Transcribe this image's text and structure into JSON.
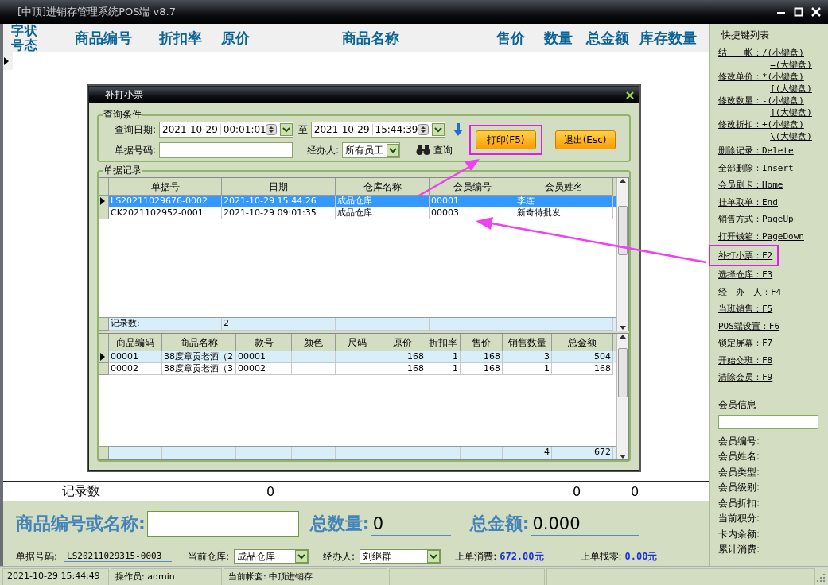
{
  "window": {
    "title": "[中顶]进销存管理系统POS端 v8.7"
  },
  "grid": {
    "columns": [
      {
        "label": "字号",
        "kind": "vertical"
      },
      {
        "label": "状态",
        "kind": "vertical"
      },
      {
        "label": "商品编号",
        "kind": "normal"
      },
      {
        "label": "折扣率",
        "kind": "normal"
      },
      {
        "label": "原价",
        "kind": "normal"
      },
      {
        "label": "商品名称",
        "kind": "normal"
      },
      {
        "label": "售价",
        "kind": "normal"
      },
      {
        "label": "数量",
        "kind": "normal"
      },
      {
        "label": "总金额",
        "kind": "normal"
      },
      {
        "label": "库存数量",
        "kind": "normal"
      }
    ],
    "summary": {
      "label": "记录数",
      "values": [
        "0",
        "0",
        "0"
      ]
    }
  },
  "entry": {
    "search_label": "商品编号或名称:",
    "qty_label": "总数量:",
    "qty": "0",
    "amount_label": "总金额:",
    "amount": "0.000"
  },
  "info": {
    "bill_label": "单据号码:",
    "bill": "LS20211029315-0003",
    "warehouse_label": "当前仓库:",
    "warehouse": "成品仓库",
    "handler_label": "经办人:",
    "handler": "刘继群",
    "last_spend_label": "上单消费:",
    "last_spend": "672.00元",
    "last_change_label": "上单找零:",
    "last_change": "0.00元"
  },
  "status_bar": {
    "cells": [
      "2021-10-29 15:44:49",
      "操作员: admin",
      "当前帐套: 中顶进销存"
    ]
  },
  "sidebar": {
    "title": "快捷键列表",
    "shortcuts": [
      {
        "lines": [
          "结　　帐：/(小键盘)",
          "=(大键盘)"
        ],
        "highlighted": false
      },
      {
        "lines": [
          "修改单价：*(小键盘)",
          "[(大键盘)"
        ],
        "highlighted": false
      },
      {
        "lines": [
          "修改数量：-(小键盘)",
          "](大键盘)"
        ],
        "highlighted": false
      },
      {
        "lines": [
          "修改折扣：+(小键盘)",
          "\\(大键盘)"
        ],
        "highlighted": false
      },
      {
        "lines": [
          "删除记录：Delete"
        ],
        "highlighted": false
      },
      {
        "lines": [
          "全部删除：Insert"
        ],
        "highlighted": false
      },
      {
        "lines": [
          "会员刷卡：Home"
        ],
        "highlighted": false
      },
      {
        "lines": [
          "挂单取单：End"
        ],
        "highlighted": false
      },
      {
        "lines": [
          "销售方式：PageUp"
        ],
        "highlighted": false
      },
      {
        "lines": [
          "打开钱箱：PageDown"
        ],
        "highlighted": false
      },
      {
        "lines": [
          "补打小票：F2"
        ],
        "highlighted": true
      },
      {
        "lines": [
          "选择仓库：F3"
        ],
        "highlighted": false
      },
      {
        "lines": [
          "经　办　人：F4"
        ],
        "highlighted": false
      },
      {
        "lines": [
          "当班销售：F5"
        ],
        "highlighted": false
      },
      {
        "lines": [
          "POS端设置：F6"
        ],
        "highlighted": false
      },
      {
        "lines": [
          "锁定屏幕：F7"
        ],
        "highlighted": false
      },
      {
        "lines": [
          "开始交班：F8"
        ],
        "highlighted": false
      },
      {
        "lines": [
          "清除会员：F9"
        ],
        "highlighted": false
      }
    ],
    "member": {
      "title": "会员信息",
      "fields": [
        "会员编号:",
        "会员姓名:",
        "会员类型:",
        "会员级别:",
        "会员折扣:",
        "当前积分:",
        "卡内余额:",
        "累计消费:"
      ]
    }
  },
  "dialog": {
    "title": "补打小票",
    "query": {
      "title": "查询条件",
      "date_label": "查询日期:",
      "from_date": "2021-10-29",
      "from_time": "00:01:01",
      "to_label": "至",
      "to_date": "2021-10-29",
      "to_time": "15:44:39",
      "bill_label": "单据号码:",
      "handler_label": "经办人:",
      "handler": "所有员工",
      "search_button": "查询",
      "buttons": [
        {
          "label": "打印(F5)",
          "highlighted": true
        },
        {
          "label": "退出(Esc)",
          "highlighted": false
        }
      ]
    },
    "records": {
      "title": "单据记录",
      "columns": [
        "单据号",
        "日期",
        "仓库名称",
        "会员编号",
        "会员姓名"
      ],
      "rows": [
        {
          "cells": [
            "LS20211029676-0002",
            "2021-10-29 15:44:26",
            "成品仓库",
            "00001",
            "李连"
          ],
          "selected": true
        },
        {
          "cells": [
            "CK2021102952-0001",
            "2021-10-29 09:01:35",
            "成品仓库",
            "00003",
            "新奇特批发"
          ],
          "selected": false
        }
      ],
      "footer": [
        "记录数:",
        "2"
      ]
    },
    "items": {
      "columns": [
        "商品编码",
        "商品名称",
        "款号",
        "颜色",
        "尺码",
        "原价",
        "折扣率",
        "售价",
        "销售数量",
        "总金额"
      ],
      "rows": [
        {
          "cells": [
            "00001",
            "38度章贡老酒（2",
            "00001",
            "",
            "",
            "168",
            "1",
            "168",
            "3",
            "504"
          ],
          "selected": true
        },
        {
          "cells": [
            "00002",
            "38度章贡老酒（3",
            "00002",
            "",
            "",
            "168",
            "1",
            "168",
            "1",
            "168"
          ],
          "selected": false
        }
      ],
      "footer": [
        "4",
        "672"
      ]
    }
  }
}
